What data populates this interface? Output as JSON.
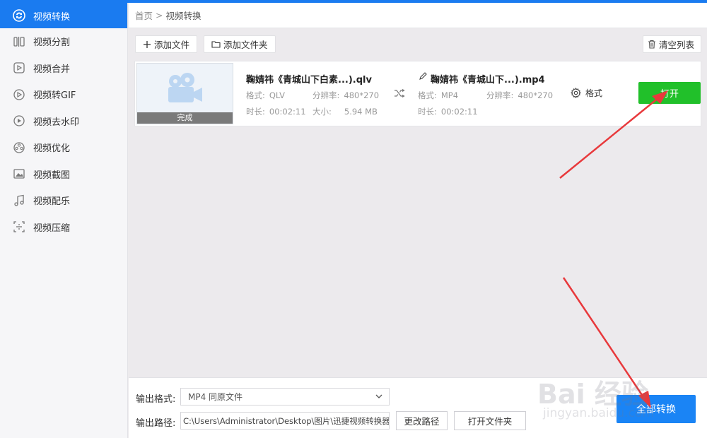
{
  "sidebar": {
    "items": [
      {
        "label": "视频转换",
        "icon": "convert-icon",
        "active": true
      },
      {
        "label": "视频分割",
        "icon": "split-icon"
      },
      {
        "label": "视频合并",
        "icon": "merge-icon"
      },
      {
        "label": "视频转GIF",
        "icon": "gif-icon"
      },
      {
        "label": "视频去水印",
        "icon": "watermark-icon"
      },
      {
        "label": "视频优化",
        "icon": "optimize-icon"
      },
      {
        "label": "视频截图",
        "icon": "screenshot-icon"
      },
      {
        "label": "视频配乐",
        "icon": "music-icon"
      },
      {
        "label": "视频压缩",
        "icon": "compress-icon"
      }
    ]
  },
  "breadcrumb": {
    "home": "首页",
    "sep": ">",
    "current": "视频转换"
  },
  "toolbar": {
    "add_file": "添加文件",
    "add_folder": "添加文件夹",
    "clear_list": "清空列表"
  },
  "file": {
    "thumb_status": "完成",
    "source": {
      "name": "鞠婧祎《青城山下白素...).qlv",
      "format_label": "格式:",
      "format": "QLV",
      "res_label": "分辨率:",
      "res": "480*270",
      "dur_label": "时长:",
      "dur": "00:02:11",
      "size_label": "大小:",
      "size": "5.94 MB"
    },
    "target": {
      "name": "鞠婧祎《青城山下...).mp4",
      "format_label": "格式:",
      "format": "MP4",
      "res_label": "分辨率:",
      "res": "480*270",
      "dur_label": "时长:",
      "dur": "00:02:11"
    },
    "settings_label": "格式",
    "open_label": "打开"
  },
  "bottom": {
    "format_label": "输出格式:",
    "format_value": "MP4  同原文件",
    "path_label": "输出路径:",
    "path_value": "C:\\Users\\Administrator\\Desktop\\图片\\迅捷视频转换器",
    "change_path": "更改路径",
    "open_folder": "打开文件夹",
    "convert_all": "全部转换"
  },
  "watermark": {
    "line1": "Bai 经验",
    "line2": "jingyan.baidu.com"
  },
  "colors": {
    "accent": "#1a7bf0",
    "green": "#21c02a",
    "arrow": "#e8393c"
  }
}
